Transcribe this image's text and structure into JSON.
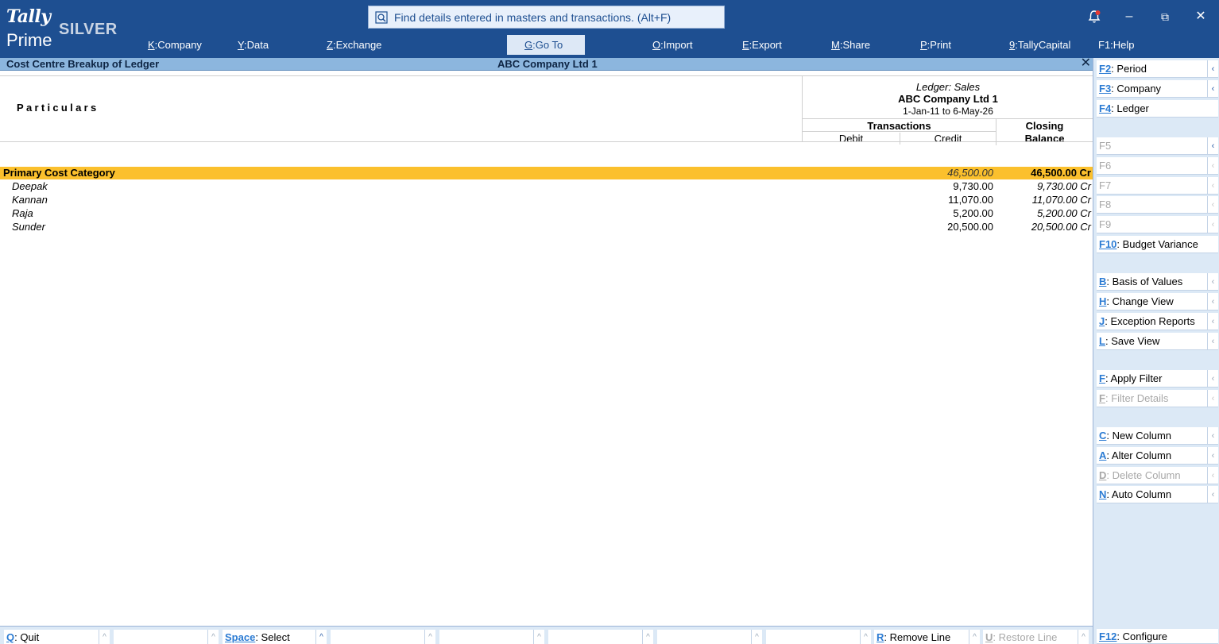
{
  "app": {
    "logo_tally": "Tally",
    "logo_prime": "Prime",
    "edition": "SILVER"
  },
  "search": {
    "placeholder": "Find details entered in masters and transactions. (Alt+F)"
  },
  "window_controls": {
    "minimize": "–",
    "restore": "⧉",
    "close": "✕"
  },
  "menu": [
    {
      "key": "K",
      "label": "Company"
    },
    {
      "key": "Y",
      "label": "Data"
    },
    {
      "key": "Z",
      "label": "Exchange"
    },
    {
      "key": "G",
      "label": "Go To"
    },
    {
      "key": "O",
      "label": "Import"
    },
    {
      "key": "E",
      "label": "Export"
    },
    {
      "key": "M",
      "label": "Share"
    },
    {
      "key": "P",
      "label": "Print"
    },
    {
      "key": "9",
      "label": "TallyCapital"
    },
    {
      "key": "F1",
      "label": "Help"
    }
  ],
  "titlebar": {
    "title": "Cost Centre Breakup of Ledger",
    "company": "ABC Company Ltd 1",
    "close": "✕"
  },
  "report": {
    "particulars": "Particulars",
    "ledger": "Ledger: Sales",
    "company": "ABC Company Ltd 1",
    "period": "1-Jan-11 to 6-May-26",
    "transactions": "Transactions",
    "debit": "Debit",
    "credit": "Credit",
    "closing_line1": "Closing",
    "closing_line2": "Balance",
    "rows": [
      {
        "name": "Primary Cost Category",
        "debit": "",
        "credit": "46,500.00",
        "closing": "46,500.00 Cr"
      },
      {
        "name": "Deepak",
        "debit": "",
        "credit": "9,730.00",
        "closing": "9,730.00 Cr"
      },
      {
        "name": "Kannan",
        "debit": "",
        "credit": "11,070.00",
        "closing": "11,070.00 Cr"
      },
      {
        "name": "Raja",
        "debit": "",
        "credit": "5,200.00",
        "closing": "5,200.00 Cr"
      },
      {
        "name": "Sunder",
        "debit": "",
        "credit": "20,500.00",
        "closing": "20,500.00 Cr"
      }
    ]
  },
  "sidebar": [
    {
      "key": "F2",
      "label": "Period",
      "enabled": true
    },
    {
      "key": "F3",
      "label": "Company",
      "enabled": true
    },
    {
      "key": "F4",
      "label": "Ledger",
      "enabled": true
    },
    {
      "key": "F5",
      "label": "",
      "enabled": false
    },
    {
      "key": "F6",
      "label": "",
      "enabled": false
    },
    {
      "key": "F7",
      "label": "",
      "enabled": false
    },
    {
      "key": "F8",
      "label": "",
      "enabled": false
    },
    {
      "key": "F9",
      "label": "",
      "enabled": false
    },
    {
      "key": "F10",
      "label": "Budget Variance",
      "enabled": true
    },
    {
      "key": "B",
      "label": "Basis of Values",
      "enabled": true
    },
    {
      "key": "H",
      "label": "Change View",
      "enabled": true
    },
    {
      "key": "J",
      "label": "Exception Reports",
      "enabled": true
    },
    {
      "key": "L",
      "label": "Save View",
      "enabled": true
    },
    {
      "key": "F",
      "label": "Apply Filter",
      "enabled": true
    },
    {
      "key": "F",
      "label": "Filter Details",
      "enabled": false
    },
    {
      "key": "C",
      "label": "New Column",
      "enabled": true
    },
    {
      "key": "A",
      "label": "Alter Column",
      "enabled": true
    },
    {
      "key": "D",
      "label": "Delete Column",
      "enabled": false
    },
    {
      "key": "N",
      "label": "Auto Column",
      "enabled": true
    },
    {
      "key": "F12",
      "label": "Configure",
      "enabled": true
    }
  ],
  "bottombar": [
    {
      "key": "Q",
      "label": "Quit",
      "enabled": true
    },
    {
      "key": "",
      "label": "",
      "enabled": false
    },
    {
      "key": "Space",
      "label": "Select",
      "enabled": true
    },
    {
      "key": "",
      "label": "",
      "enabled": false
    },
    {
      "key": "",
      "label": "",
      "enabled": false
    },
    {
      "key": "",
      "label": "",
      "enabled": false
    },
    {
      "key": "",
      "label": "",
      "enabled": false
    },
    {
      "key": "",
      "label": "",
      "enabled": false
    },
    {
      "key": "R",
      "label": "Remove Line",
      "enabled": true
    },
    {
      "key": "U",
      "label": "Restore Line",
      "enabled": false
    }
  ]
}
